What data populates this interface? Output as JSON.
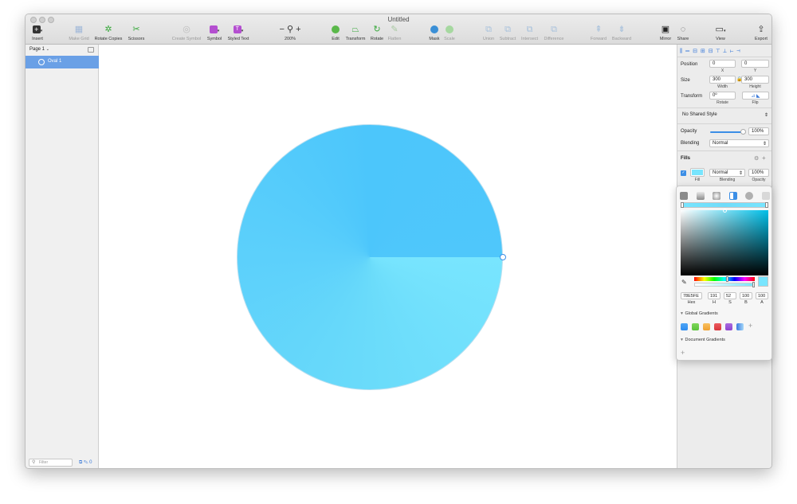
{
  "window": {
    "title": "Untitled"
  },
  "toolbar": {
    "insert": "Insert",
    "make_grid": "Make Grid",
    "rotate_copies": "Rotate Copies",
    "scissors": "Scissors",
    "create_symbol": "Create Symbol",
    "symbol": "Symbol",
    "styled_text": "Styled Text",
    "zoom": "200%",
    "edit": "Edit",
    "transform": "Transform",
    "rotate": "Rotate",
    "flatten": "Flatten",
    "mask": "Mask",
    "scale": "Scale",
    "union": "Union",
    "subtract": "Subtract",
    "intersect": "Intersect",
    "difference": "Difference",
    "forward": "Forward",
    "backward": "Backward",
    "mirror": "Mirror",
    "share": "Share",
    "view": "View",
    "export": "Export"
  },
  "layers": {
    "page": "Page 1",
    "items": [
      {
        "name": "Oval 1"
      }
    ],
    "filter_placeholder": "Filter",
    "count": "0"
  },
  "inspector": {
    "position_label": "Position",
    "x": "0",
    "y": "0",
    "x_label": "X",
    "y_label": "Y",
    "size_label": "Size",
    "width": "300",
    "height": "300",
    "width_label": "Width",
    "height_label": "Height",
    "transform_label": "Transform",
    "rotate": "0º",
    "rotate_label": "Rotate",
    "flip_label": "Flip",
    "shared_style": "No Shared Style",
    "opacity_label": "Opacity",
    "opacity": "100%",
    "blending_label": "Blending",
    "blending": "Normal",
    "fills_label": "Fills",
    "fill_blending": "Normal",
    "fill_opacity": "100%",
    "fill_sub_fill": "Fill",
    "fill_sub_blending": "Blending",
    "fill_sub_opacity": "Opacity"
  },
  "color_picker": {
    "hex": "78E5FE",
    "h": "191",
    "s": "52",
    "b": "100",
    "a": "100",
    "hex_label": "Hex",
    "h_label": "H",
    "s_label": "S",
    "b_label": "B",
    "a_label": "A",
    "global_gradients": "Global Gradients",
    "document_gradients": "Document Gradients"
  },
  "colors": {
    "selection": "#6aa0e6",
    "fill": "#78e5fe",
    "accent": "#3b8ee6",
    "gradients": [
      "#2d8cf0",
      "#5ac33a",
      "#f0a030",
      "#d8353a",
      "#8e45d0",
      "#3a7ae0"
    ]
  }
}
